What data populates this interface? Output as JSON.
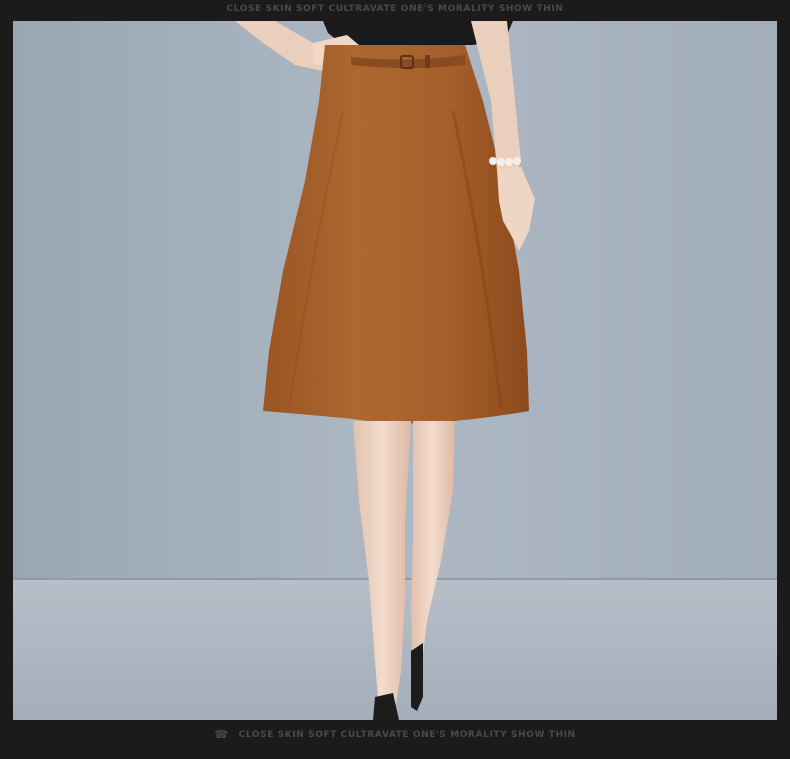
{
  "header": {
    "caption": "CLOSE SKIN SOFT CULTRAVATE ONE'S MORALITY SHOW THIN"
  },
  "footer": {
    "caption": "CLOSE SKIN SOFT CULTRAVATE ONE'S MORALITY SHOW THIN",
    "icon": "phone-icon"
  },
  "photo": {
    "subject": "product-photo-brown-a-line-skirt",
    "colors": {
      "wall": "#a7b2bf",
      "floor": "#aeb7c2",
      "skirt": "#a8622c",
      "skin": "#ecd2c0",
      "top": "#1a1a1a",
      "frame": "#1c1a1a"
    }
  }
}
